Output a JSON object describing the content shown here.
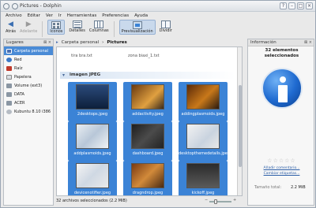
{
  "window": {
    "title": "Pictures - Dolphin"
  },
  "menu": [
    "Archivo",
    "Editar",
    "Ver",
    "Ir",
    "Herramientas",
    "Preferencias",
    "Ayuda"
  ],
  "toolbar": {
    "back": "Atrás",
    "forward": "Adelante",
    "icons": "Iconos",
    "details": "Detalles",
    "columns": "Columnas",
    "preview": "Previsualización",
    "split": "Dividir"
  },
  "places": {
    "title": "Lugares",
    "items": [
      "Carpeta personal",
      "Red",
      "Raíz",
      "Papelera",
      "Volume (ext3)",
      "DATA",
      "ACER",
      "Kubuntu 8.10 i386"
    ]
  },
  "breadcrumb": {
    "parent": "Carpeta personal",
    "current": "Pictures"
  },
  "content": {
    "prev_files": [
      "tira bra.txt",
      "zona biaxi_1.txt"
    ],
    "group": "imagen JPEG",
    "files": [
      "2desktops.jpeg",
      "addactivity.jpeg",
      "addingplasmoids.jpeg",
      "addplasmoids.jpeg",
      "dashboard.jpeg",
      "desktopthemedetails.jpeg",
      "devicenotifier.jpeg",
      "dragndrop.jpeg",
      "kickoff.jpeg"
    ]
  },
  "info": {
    "title": "Información",
    "count": "32 elementos seleccionados",
    "rating": "☆☆☆☆☆",
    "add_comment": "Añadir comentario...",
    "change_tags": "Cambiar etiquetas...",
    "size_label": "Tamaño total:",
    "size_value": "2.2 MiB"
  },
  "status": {
    "text": "32 archivos seleccionados (2.2 MiB)"
  },
  "icons": {
    "back": "arrow-left-icon",
    "forward": "arrow-right-icon",
    "info_big": "information-icon",
    "places_item": "folder-icon"
  },
  "colors": {
    "selection": "#3b83d6",
    "accent": "#4a8bd6"
  }
}
